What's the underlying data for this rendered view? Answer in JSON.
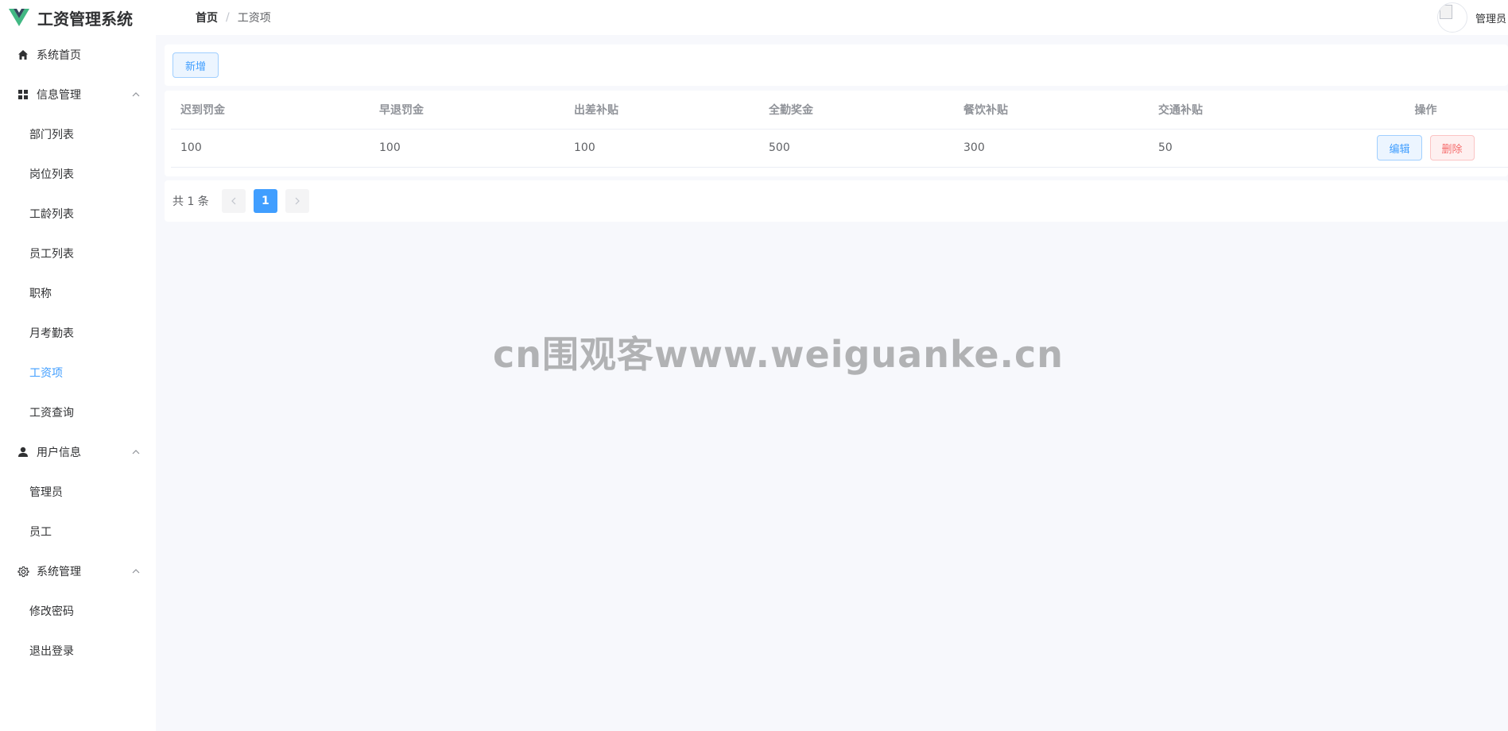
{
  "app": {
    "title": "工资管理系统",
    "logo_icon": "vue-logo-icon",
    "accent_color": "#409eff"
  },
  "breadcrumb": {
    "home": "首页",
    "separator": "/",
    "current": "工资项"
  },
  "user": {
    "name": "管理员",
    "avatar_icon": "broken-image-icon"
  },
  "sidebar": {
    "items": [
      {
        "label": "系统首页",
        "icon": "home-icon",
        "level": "top"
      },
      {
        "label": "信息管理",
        "icon": "grid-icon",
        "level": "top",
        "expanded": true
      },
      {
        "label": "部门列表",
        "level": "sub"
      },
      {
        "label": "岗位列表",
        "level": "sub"
      },
      {
        "label": "工龄列表",
        "level": "sub"
      },
      {
        "label": "员工列表",
        "level": "sub"
      },
      {
        "label": "职称",
        "level": "sub"
      },
      {
        "label": "月考勤表",
        "level": "sub"
      },
      {
        "label": "工资项",
        "level": "sub",
        "active": true
      },
      {
        "label": "工资查询",
        "level": "sub"
      },
      {
        "label": "用户信息",
        "icon": "user-icon",
        "level": "top",
        "expanded": true
      },
      {
        "label": "管理员",
        "level": "sub"
      },
      {
        "label": "员工",
        "level": "sub"
      },
      {
        "label": "系统管理",
        "icon": "gear-icon",
        "level": "top",
        "expanded": true
      },
      {
        "label": "修改密码",
        "level": "sub"
      },
      {
        "label": "退出登录",
        "level": "sub"
      }
    ]
  },
  "toolbar": {
    "add_label": "新增"
  },
  "table": {
    "columns": [
      "迟到罚金",
      "早退罚金",
      "出差补贴",
      "全勤奖金",
      "餐饮补贴",
      "交通补贴",
      "操作"
    ],
    "rows": [
      {
        "cells": [
          "100",
          "100",
          "100",
          "500",
          "300",
          "50"
        ],
        "edit_label": "编辑",
        "delete_label": "删除"
      }
    ]
  },
  "pagination": {
    "total_text": "共 1 条",
    "prev_icon": "chevron-left-icon",
    "next_icon": "chevron-right-icon",
    "current_page": "1"
  },
  "watermark": {
    "text": "cn围观客www.weiguanke.cn"
  }
}
